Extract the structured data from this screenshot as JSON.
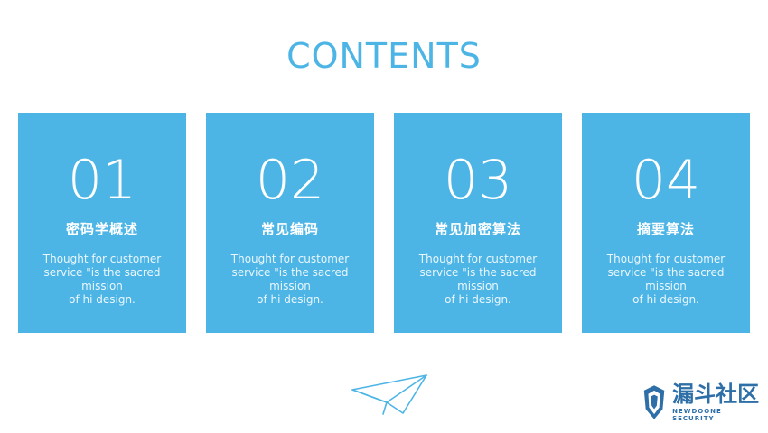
{
  "title": "CONTENTS",
  "colors": {
    "accent": "#4cb5e6",
    "card_text": "#ffffff",
    "logo": "#2e6fa8"
  },
  "cards": [
    {
      "number": "01",
      "heading": "密码学概述",
      "desc_lines": [
        "Thought for customer",
        "service \"is the sacred mission",
        "of hi design."
      ]
    },
    {
      "number": "02",
      "heading": "常见编码",
      "desc_lines": [
        "Thought for customer",
        "service \"is the sacred mission",
        "of hi design."
      ]
    },
    {
      "number": "03",
      "heading": "常见加密算法",
      "desc_lines": [
        "Thought for customer",
        "service \"is the sacred mission",
        "of hi design."
      ]
    },
    {
      "number": "04",
      "heading": "摘要算法",
      "desc_lines": [
        "Thought for customer",
        "service \"is the sacred mission",
        "of hi design."
      ]
    }
  ],
  "decorations": {
    "plane_icon": "paper-plane-icon"
  },
  "logo": {
    "main": "漏斗社区",
    "sub": "NEWDOONE SECURITY",
    "icon": "shield-icon"
  }
}
